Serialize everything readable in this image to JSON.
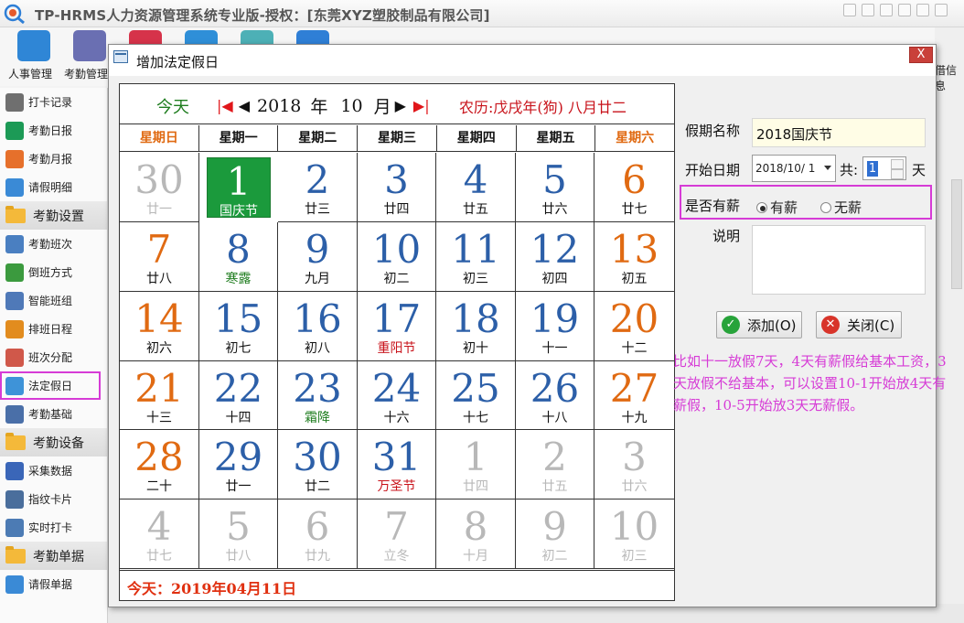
{
  "app": {
    "title": "TP-HRMS人力资源管理系统专业版-授权：[东莞XYZ塑胶制品有限公司]",
    "right_partial_label": "借信息"
  },
  "toolbar": [
    {
      "label": "人事管理",
      "icon": "personnel-icon",
      "color": "#2f86d6"
    },
    {
      "label": "考勤管理",
      "icon": "calendar-icon",
      "color": "#6a6fb2"
    },
    {
      "label": "",
      "icon": "schedule-icon",
      "color": "#d6334a"
    },
    {
      "label": "",
      "icon": "send-icon",
      "color": "#2f8fd8"
    },
    {
      "label": "",
      "icon": "cloud-icon",
      "color": "#4db0b6"
    },
    {
      "label": "",
      "icon": "settings-icon",
      "color": "#2f7fd6"
    }
  ],
  "sidebar": [
    {
      "type": "item",
      "label": "打卡记录",
      "icon": "punch-record-icon",
      "color": "#6f6f6f"
    },
    {
      "type": "item",
      "label": "考勤日报",
      "icon": "daily-report-icon",
      "color": "#1c9a56"
    },
    {
      "type": "item",
      "label": "考勤月报",
      "icon": "monthly-report-icon",
      "color": "#e6702b"
    },
    {
      "type": "item",
      "label": "请假明细",
      "icon": "leave-detail-icon",
      "color": "#3a8ad6"
    },
    {
      "type": "group",
      "label": "考勤设置"
    },
    {
      "type": "item",
      "label": "考勤班次",
      "icon": "clock-icon",
      "color": "#4a7fc1"
    },
    {
      "type": "item",
      "label": "倒班方式",
      "icon": "rotation-icon",
      "color": "#3b9a3e"
    },
    {
      "type": "item",
      "label": "智能班组",
      "icon": "smart-group-icon",
      "color": "#4f79b8"
    },
    {
      "type": "item",
      "label": "排班日程",
      "icon": "timer-icon",
      "color": "#e28c1e"
    },
    {
      "type": "item",
      "label": "班次分配",
      "icon": "user-assign-icon",
      "color": "#d0584a"
    },
    {
      "type": "item",
      "label": "法定假日",
      "icon": "holiday-icon",
      "color": "#3e93d8",
      "highlight": true
    },
    {
      "type": "item",
      "label": "考勤基础",
      "icon": "gear-icon",
      "color": "#4a6fa8"
    },
    {
      "type": "group",
      "label": "考勤设备"
    },
    {
      "type": "item",
      "label": "采集数据",
      "icon": "download-icon",
      "color": "#3a66b8"
    },
    {
      "type": "item",
      "label": "指纹卡片",
      "icon": "card-icon",
      "color": "#4a6e9c"
    },
    {
      "type": "item",
      "label": "实时打卡",
      "icon": "monitor-icon",
      "color": "#4c7bb4"
    },
    {
      "type": "group",
      "label": "考勤单据"
    },
    {
      "type": "item",
      "label": "请假单据",
      "icon": "leave-form-icon",
      "color": "#3a8ad6"
    }
  ],
  "dialog": {
    "title": "增加法定假日",
    "close_label": "X",
    "calendar": {
      "today_label": "今天",
      "year": "2018",
      "year_unit": "年",
      "month": "10",
      "month_unit": "月",
      "lunar_label": "农历:戊戌年(狗) 八月廿二",
      "weekdays": [
        "星期日",
        "星期一",
        "星期二",
        "星期三",
        "星期四",
        "星期五",
        "星期六"
      ],
      "weeks": [
        [
          {
            "d": "30",
            "l": "廿一",
            "t": "other"
          },
          {
            "d": "1",
            "l": "国庆节",
            "t": "sel"
          },
          {
            "d": "2",
            "l": "廿三",
            "t": "cur"
          },
          {
            "d": "3",
            "l": "廿四",
            "t": "cur"
          },
          {
            "d": "4",
            "l": "廿五",
            "t": "cur"
          },
          {
            "d": "5",
            "l": "廿六",
            "t": "cur"
          },
          {
            "d": "6",
            "l": "廿七",
            "t": "we"
          }
        ],
        [
          {
            "d": "7",
            "l": "廿八",
            "t": "we"
          },
          {
            "d": "8",
            "l": "寒露",
            "t": "cur",
            "s": "term"
          },
          {
            "d": "9",
            "l": "九月",
            "t": "cur"
          },
          {
            "d": "10",
            "l": "初二",
            "t": "cur"
          },
          {
            "d": "11",
            "l": "初三",
            "t": "cur"
          },
          {
            "d": "12",
            "l": "初四",
            "t": "cur"
          },
          {
            "d": "13",
            "l": "初五",
            "t": "we"
          }
        ],
        [
          {
            "d": "14",
            "l": "初六",
            "t": "we"
          },
          {
            "d": "15",
            "l": "初七",
            "t": "cur"
          },
          {
            "d": "16",
            "l": "初八",
            "t": "cur"
          },
          {
            "d": "17",
            "l": "重阳节",
            "t": "cur",
            "s": "fest"
          },
          {
            "d": "18",
            "l": "初十",
            "t": "cur"
          },
          {
            "d": "19",
            "l": "十一",
            "t": "cur"
          },
          {
            "d": "20",
            "l": "十二",
            "t": "we"
          }
        ],
        [
          {
            "d": "21",
            "l": "十三",
            "t": "we"
          },
          {
            "d": "22",
            "l": "十四",
            "t": "cur"
          },
          {
            "d": "23",
            "l": "霜降",
            "t": "cur",
            "s": "term"
          },
          {
            "d": "24",
            "l": "十六",
            "t": "cur"
          },
          {
            "d": "25",
            "l": "十七",
            "t": "cur"
          },
          {
            "d": "26",
            "l": "十八",
            "t": "cur"
          },
          {
            "d": "27",
            "l": "十九",
            "t": "we"
          }
        ],
        [
          {
            "d": "28",
            "l": "二十",
            "t": "we"
          },
          {
            "d": "29",
            "l": "廿一",
            "t": "cur"
          },
          {
            "d": "30",
            "l": "廿二",
            "t": "cur"
          },
          {
            "d": "31",
            "l": "万圣节",
            "t": "cur",
            "s": "fest"
          },
          {
            "d": "1",
            "l": "廿四",
            "t": "other"
          },
          {
            "d": "2",
            "l": "廿五",
            "t": "other"
          },
          {
            "d": "3",
            "l": "廿六",
            "t": "other"
          }
        ],
        [
          {
            "d": "4",
            "l": "廿七",
            "t": "other"
          },
          {
            "d": "5",
            "l": "廿八",
            "t": "other"
          },
          {
            "d": "6",
            "l": "廿九",
            "t": "other"
          },
          {
            "d": "7",
            "l": "立冬",
            "t": "other"
          },
          {
            "d": "8",
            "l": "十月",
            "t": "other"
          },
          {
            "d": "9",
            "l": "初二",
            "t": "other"
          },
          {
            "d": "10",
            "l": "初三",
            "t": "other"
          }
        ]
      ],
      "footer": "今天：2019年04月11日"
    },
    "form": {
      "holiday_name_label": "假期名称",
      "holiday_name_value": "2018国庆节",
      "start_date_label": "开始日期",
      "start_date_value": "2018/10/ 1",
      "total_label": "共:",
      "days_value": "1",
      "days_unit": "天",
      "paid_label": "是否有薪",
      "paid_option": "有薪",
      "unpaid_option": "无薪",
      "memo_label": "说明",
      "add_button": "添加(O)",
      "close_button": "关闭(C)"
    }
  },
  "annotation": "比如十一放假7天，4天有薪假给基本工资，3天放假不给基本，可以设置10-1开始放4天有薪假，10-5开始放3天无薪假。"
}
